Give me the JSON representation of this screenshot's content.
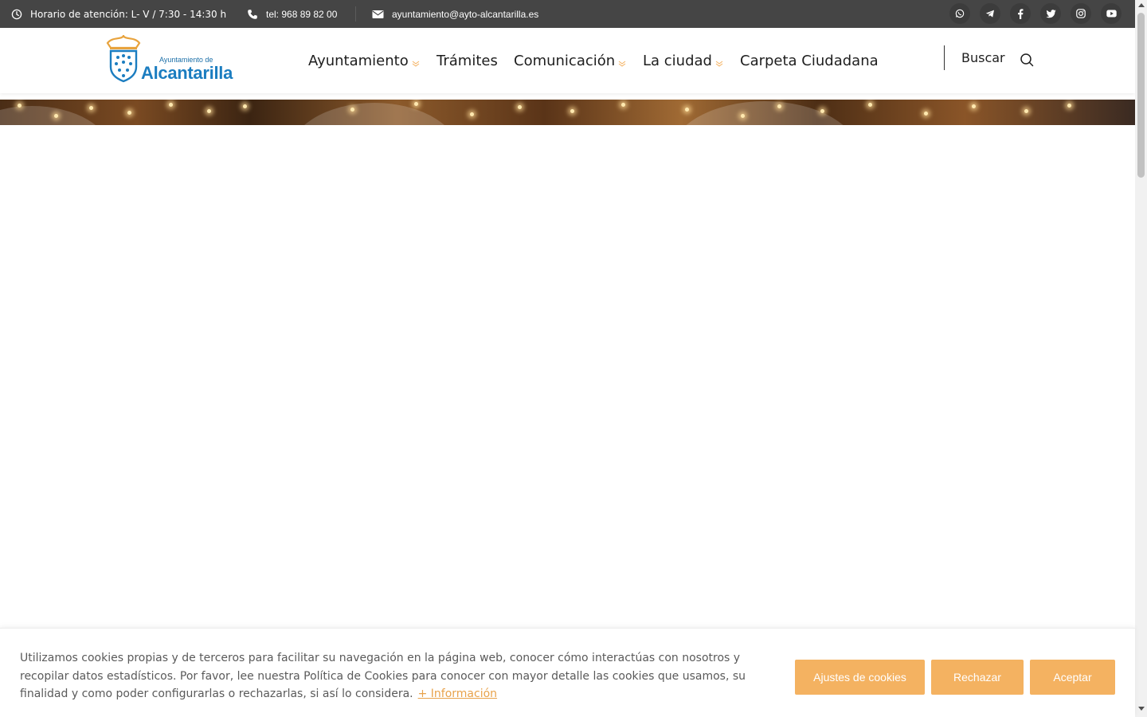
{
  "topbar": {
    "hours": "Horario de atención: L- V / 7:30 - 14:30 h",
    "phone": "tel: 968 89 82 00",
    "email": "ayuntamiento@ayto-alcantarilla.es",
    "social_icons": [
      "whatsapp-icon",
      "telegram-icon",
      "facebook-icon",
      "twitter-icon",
      "instagram-icon",
      "youtube-icon"
    ]
  },
  "header": {
    "logo_line1": "Ayuntamiento de",
    "logo_line2": "Alcantarilla",
    "nav": [
      {
        "label": "Ayuntamiento",
        "dropdown": true
      },
      {
        "label": "Trámites",
        "dropdown": false
      },
      {
        "label": "Comunicación",
        "dropdown": true
      },
      {
        "label": "La ciudad",
        "dropdown": true
      },
      {
        "label": "Carpeta Ciudadana",
        "dropdown": false
      }
    ],
    "search_label": "Buscar"
  },
  "cookie": {
    "text": "Utilizamos cookies propias y de terceros para facilitar su navegación en la página web, conocer cómo interactúas con nosotros y recopilar datos estadísticos. Por favor, lee nuestra Política de Cookies para conocer con mayor detalle las cookies que usamos, su finalidad y como poder configurarlas o rechazarlas, si así lo considera.",
    "link": "+ Información",
    "settings_button": "Ajustes de cookies",
    "reject_button": "Rechazar",
    "accept_button": "Aceptar"
  },
  "colors": {
    "topbar_bg": "#454545",
    "accent": "#f4b261",
    "link": "#e8a24a",
    "logo_blue": "#1b7dc0",
    "logo_gold": "#e8a33d"
  }
}
